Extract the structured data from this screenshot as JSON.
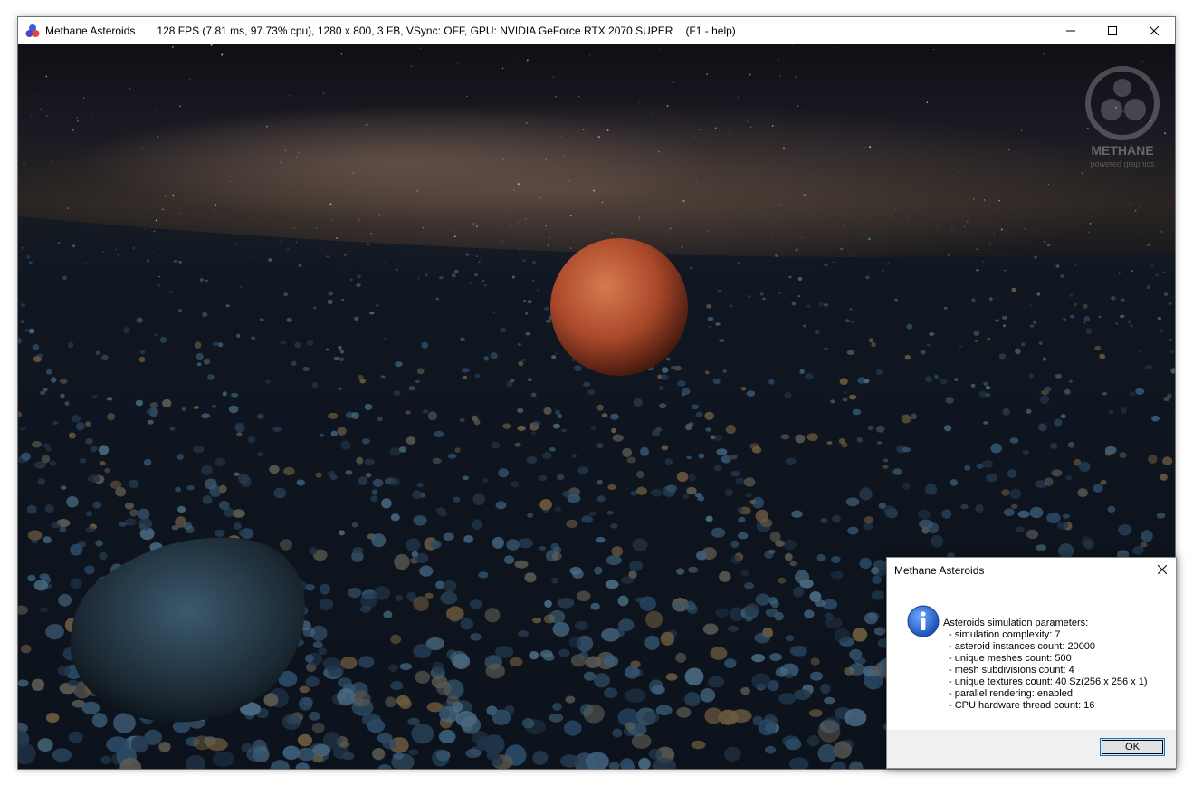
{
  "window": {
    "app_title": "Methane Asteroids",
    "status_text": "128 FPS (7.81 ms, 97.73% cpu), 1280 x 800, 3 FB, VSync: OFF, GPU: NVIDIA GeForce RTX 2070 SUPER",
    "help_hint": "(F1 - help)",
    "controls": [
      "minimize-icon",
      "maximize-icon",
      "close-icon"
    ]
  },
  "scene": {
    "logo_text": "METHANE",
    "logo_subtext": "powered graphics"
  },
  "dialog": {
    "title": "Asteroids simulation parameters:",
    "window_title": "Methane Asteroids",
    "icon": "info-icon",
    "lines": [
      "- simulation complexity: 7",
      "- asteroid instances count: 20000",
      "- unique meshes count: 500",
      "- mesh subdivisions count: 4",
      "- unique textures count: 40 Sz(256 x 256 x 1)",
      "- parallel rendering: enabled",
      "- CPU hardware thread count: 16"
    ],
    "ok_label": "OK"
  },
  "colors": {
    "planet": "#b4552e",
    "accent": "#0078d7",
    "space": "#0b0f16"
  }
}
